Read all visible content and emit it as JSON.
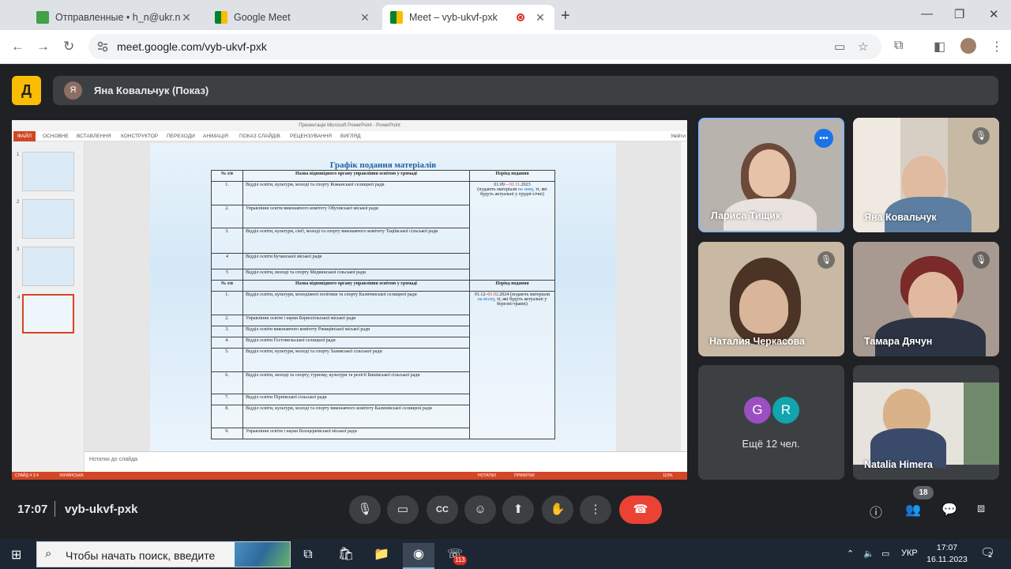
{
  "browser": {
    "tabs": [
      {
        "title": "Отправленные • h_n@ukr.net"
      },
      {
        "title": "Google Meet"
      },
      {
        "title": "Meet – vyb-ukvf-pxk"
      }
    ],
    "url": "meet.google.com/vyb-ukvf-pxk"
  },
  "meet": {
    "presenter_initial": "Я",
    "presenter_label": "Яна Ковальчук (Показ)",
    "logo_text": "Д",
    "time": "17:07",
    "meeting_code": "vyb-ukvf-pxk",
    "participant_count": "18"
  },
  "ppt": {
    "window_title": "Презентація Microsoft PowerPoint - PowerPoint",
    "ribbon": [
      "ФАЙЛ",
      "ОСНОВНЕ",
      "ВСТАВЛЕННЯ",
      "КОНСТРУКТОР",
      "ПЕРЕХОДИ",
      "АНІМАЦІЯ",
      "ПОКАЗ СЛАЙДІВ",
      "РЕЦЕНЗУВАННЯ",
      "ВИГЛЯД"
    ],
    "signin": "Увійти",
    "thumb_numbers": [
      "1",
      "2",
      "3",
      "4"
    ],
    "notes_placeholder": "Нотатки до слайда",
    "status_left": "СЛАЙД 4 З 4",
    "status_lang": "УКРАЇНСЬКА",
    "status_notes": "НОТАТКИ",
    "status_comments": "ПРИМІТКИ",
    "zoom": "110%",
    "slide": {
      "title": "Графік подання матеріалів",
      "header": {
        "num": "№ з/п",
        "name": "Назва відповідного органу управління освітою у громаді",
        "period": "Період подання"
      },
      "rows1": [
        {
          "num": "1.",
          "name": "Відділ освіти, культури, молоді та спорту Кожанської селищної ради"
        },
        {
          "num": "2.",
          "name": "Управління освіти виконавчого комітету Обухівської міської ради"
        },
        {
          "num": "3.",
          "name": "Відділ освіти, культури, сім'ї, молоді та спорту виконавчого комітету Таціївської сільської ради"
        },
        {
          "num": "4",
          "name": "Відділ освіти Бучанської міської ради"
        },
        {
          "num": "5",
          "name": "Відділ освіти, молоді та спорту Медвинської сільської ради"
        }
      ],
      "period1": {
        "date_start": "01.09 – ",
        "date_end": "01.11",
        "year": ".2023",
        "text_a": "(подають матеріали ",
        "season": "на зиму",
        "text_b": ", ті, які будуть актуальні у грудні-січні)"
      },
      "rows2": [
        {
          "num": "1.",
          "name": "Відділ освіти, культури, молодіжної політики та спорту Калитянської селищної ради"
        },
        {
          "num": "2.",
          "name": "Управління освіти і науки Бориспільської міської ради"
        },
        {
          "num": "3.",
          "name": "Відділ освіти виконавчого комітету Ржищівської міської ради"
        },
        {
          "num": "4.",
          "name": "Відділ освіти Гостомельської селищної ради"
        },
        {
          "num": "5.",
          "name": "Відділ освіти, культури, молоді та спорту Зазимської сільської ради"
        },
        {
          "num": "6.",
          "name": "Відділ освіти, молоді та спорту, туризму, культури та релігії Бишівської сільської ради"
        },
        {
          "num": "7.",
          "name": "Відділ освіти Пірнівської сільської ради"
        },
        {
          "num": "8.",
          "name": "Відділ освіти, культури, молоді та спорту виконавчого комітету Калинівської селищної ради"
        },
        {
          "num": "9.",
          "name": "Управління освіти і науки Білоцерківської міської ради"
        }
      ],
      "period2": {
        "date_start": "01.12–",
        "date_end": "01.02",
        "year": ".2024",
        "text_a": " (подають матеріали ",
        "season": "на весну",
        "text_b": ", ті, які будуть актуальні у березні-травні)"
      }
    }
  },
  "participants": [
    {
      "name": "Лариса Тищик"
    },
    {
      "name": "Яна Ковальчук"
    },
    {
      "name": "Наталия Черкасова"
    },
    {
      "name": "Тамара Дячун"
    },
    {
      "name": "Natalia Himera"
    }
  ],
  "more": {
    "a": "G",
    "b": "R",
    "label": "Ещё 12 чел."
  },
  "taskbar": {
    "search_placeholder": "Чтобы начать поиск, введите",
    "viber_badge": "113",
    "lang": "УКР",
    "time": "17:07",
    "date": "16.11.2023",
    "notif_count": "2"
  },
  "colors": {
    "accent": "#1a73e8",
    "end_call": "#ea4335",
    "logo": "#fbbc04",
    "ppt": "#d24726"
  }
}
